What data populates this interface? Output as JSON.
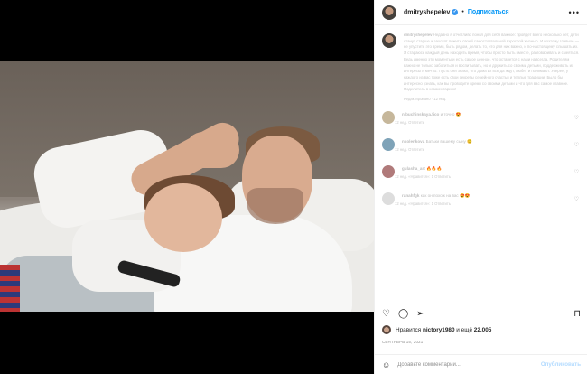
{
  "header": {
    "username": "dmitryshepelev",
    "separator": "•",
    "follow_label": "Подписаться",
    "more_icon": "•••",
    "verified_icon": "✓"
  },
  "caption": {
    "username": "dmitryshepelev",
    "text": "Недавно я отчетливо понял для себя важное: пройдет всего несколько лет, дети станут старше и захотят пожить своей самостоятельной взрослой жизнью. И поэтому главное — не упустить это время, быть рядом, делать то, что для них важно, и по-настоящему слышать их. Я стараюсь каждый день находить время, чтобы просто быть вместе, разговаривать и смеяться. Ведь именно эти моменты и есть самое ценное, что останется с нами навсегда. Родителям важно не только заботиться и воспитывать, но и дружить со своими детьми, поддерживать их интересы и мечты. Пусть они знают, что дома их всегда ждут, любят и понимают. Уверен, у каждого из вас тоже есть свои секреты семейного счастья и теплые традиции. Было бы интересно узнать, как вы проводите время со своими детьми и что для вас самое главное. Поделитесь в комментариях!",
    "date": "Редактировано · 12 нед."
  },
  "comments": [
    {
      "username": "n.buchinskaya.fico",
      "text": "и точно",
      "emoji": "😍",
      "meta": "12 нед.  Ответить",
      "color": "#c6b79b"
    },
    {
      "username": "nkolenkova",
      "text": "Батьки вашему сыну",
      "emoji": "😊",
      "meta": "12 нед.  Ответить",
      "color": "#7fa3b8"
    },
    {
      "username": "gulasha_art",
      "text": "",
      "emoji": "🔥🔥🔥",
      "meta": "12 нед.  «Нравится»: 1  Ответить",
      "color": "#b07a7a"
    },
    {
      "username": "ranahfgk",
      "text": "как он похож на вас",
      "emoji": "😍😍",
      "meta": "12 нед.  «Нравится»: 1  Ответить",
      "color": "#dddddd"
    }
  ],
  "actions": {
    "like_icon": "♡",
    "comment_icon": "◯",
    "share_icon": "➢",
    "save_icon": "⊓",
    "comment_heart": "♡"
  },
  "likes": {
    "prefix": "Нравится",
    "user": "nictory1980",
    "middle": "и ещё",
    "count": "22,005"
  },
  "post_date": "СЕНТЯБРЬ 15, 2021",
  "add_comment": {
    "emoji_icon": "☺",
    "placeholder": "Добавьте комментарий...",
    "publish_label": "Опубликовать"
  }
}
